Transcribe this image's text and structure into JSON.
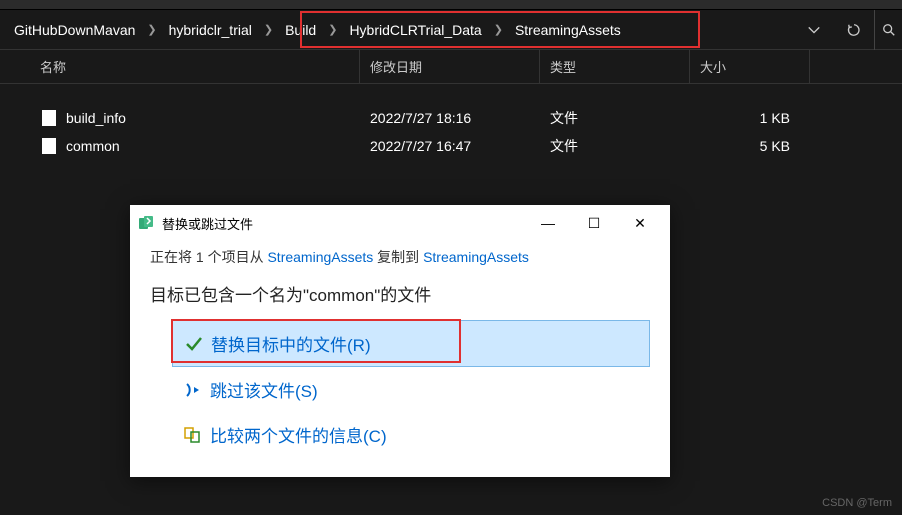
{
  "breadcrumb": {
    "items": [
      "GitHubDownMavan",
      "hybridclr_trial",
      "Build",
      "HybridCLRTrial_Data",
      "StreamingAssets"
    ]
  },
  "columns": {
    "name": "名称",
    "date": "修改日期",
    "type": "类型",
    "size": "大小"
  },
  "files": [
    {
      "name": "build_info",
      "date": "2022/7/27 18:16",
      "type": "文件",
      "size": "1 KB"
    },
    {
      "name": "common",
      "date": "2022/7/27 16:47",
      "type": "文件",
      "size": "5 KB"
    }
  ],
  "dialog": {
    "title": "替换或跳过文件",
    "msg_prefix": "正在将 1 个项目从 ",
    "msg_src": "StreamingAssets",
    "msg_mid": " 复制到 ",
    "msg_dst": "StreamingAssets",
    "question_pre": "目标已包含一个名为\"",
    "question_name": "common",
    "question_post": "\"的文件",
    "opt_replace": "替换目标中的文件(R)",
    "opt_skip": "跳过该文件(S)",
    "opt_compare": "比较两个文件的信息(C)"
  },
  "watermark": "CSDN @Term"
}
